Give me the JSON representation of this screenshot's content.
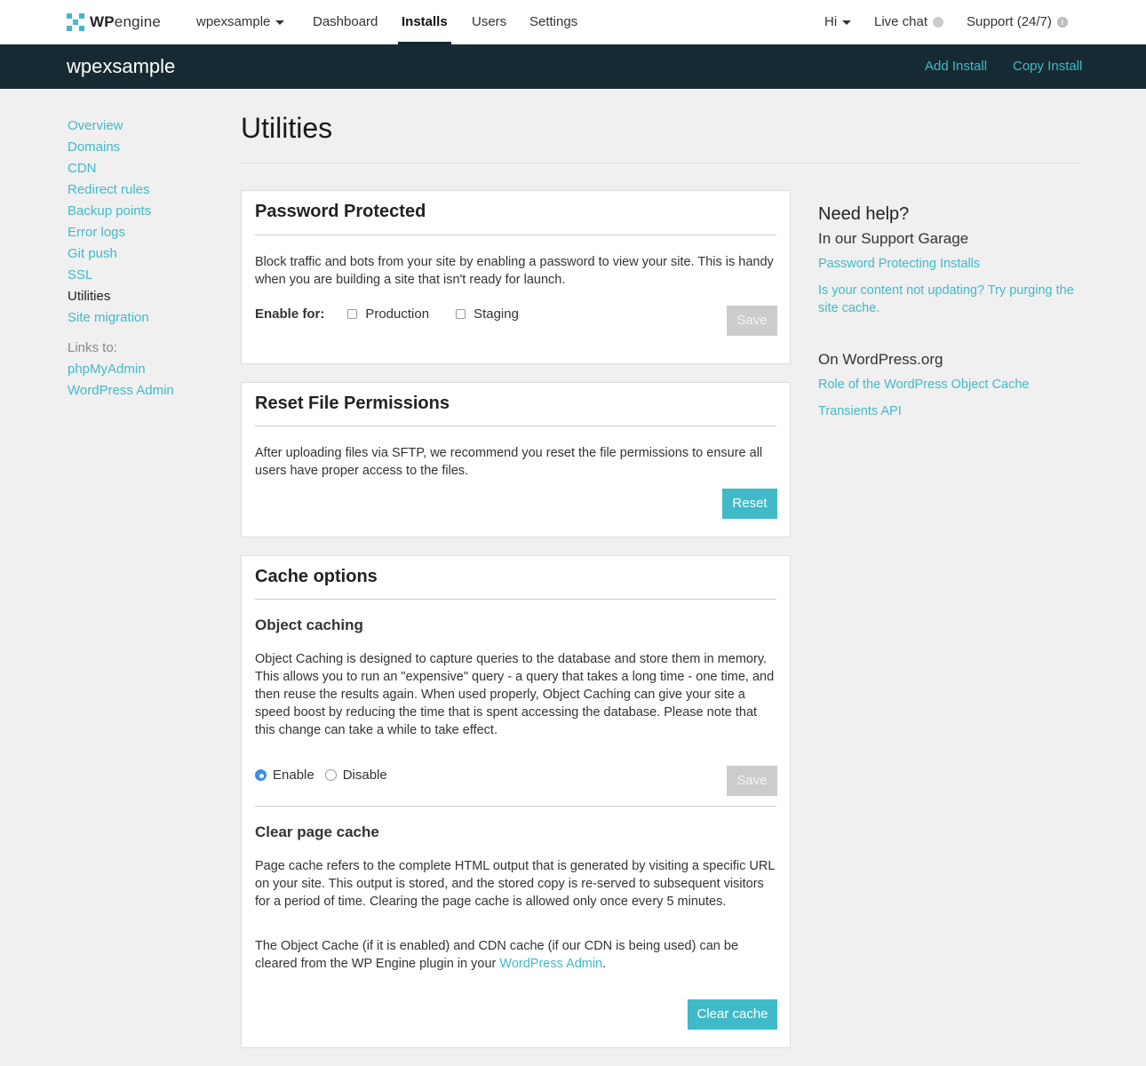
{
  "header": {
    "logo_bold": "WP",
    "logo_light": "engine",
    "site_switcher": "wpexsample",
    "nav": {
      "dashboard": "Dashboard",
      "installs": "Installs",
      "users": "Users",
      "settings": "Settings"
    },
    "greeting": "Hi",
    "live_chat": "Live chat",
    "support": "Support (24/7)"
  },
  "sitebar": {
    "site_name": "wpexsample",
    "add_install": "Add Install",
    "copy_install": "Copy Install"
  },
  "sidebar": {
    "items": [
      "Overview",
      "Domains",
      "CDN",
      "Redirect rules",
      "Backup points",
      "Error logs",
      "Git push",
      "SSL",
      "Utilities",
      "Site migration"
    ],
    "current": "Utilities",
    "links_label": "Links to:",
    "links": [
      "phpMyAdmin",
      "WordPress Admin"
    ]
  },
  "main": {
    "title": "Utilities",
    "password_card": {
      "title": "Password Protected",
      "text": "Block traffic and bots from your site by enabling a password to view your site. This is handy when you are building a site that isn't ready for launch.",
      "enable_label": "Enable for:",
      "production": "Production",
      "staging": "Staging",
      "save": "Save"
    },
    "reset_card": {
      "title": "Reset File Permissions",
      "text": "After uploading files via SFTP, we recommend you reset the file permissions to ensure all users have proper access to the files.",
      "reset": "Reset"
    },
    "cache_card": {
      "title": "Cache options",
      "object_title": "Object caching",
      "object_text": "Object Caching is designed to capture queries to the database and store them in memory. This allows you to run an \"expensive\" query - a query that takes a long time - one time, and then reuse the results again. When used properly, Object Caching can give your site a speed boost by reducing the time that is spent accessing the database. Please note that this change can take a while to take effect.",
      "enable": "Enable",
      "disable": "Disable",
      "selected": "Enable",
      "save": "Save",
      "clear_title": "Clear page cache",
      "clear_text": "Page cache refers to the complete HTML output that is generated by visiting a specific URL on your site. This output is stored, and the stored copy is re-served to subsequent visitors for a period of time. Clearing the page cache is allowed only once every 5 minutes.",
      "note_before": "The Object Cache (if it is enabled) and CDN cache (if our CDN is being used) can be cleared from the WP Engine plugin in your ",
      "note_link": "WordPress Admin",
      "note_after": ".",
      "clear_button": "Clear cache"
    }
  },
  "help": {
    "heading": "Need help?",
    "support_garage": "In our Support Garage",
    "garage_links": [
      "Password Protecting Installs",
      "Is your content not updating? Try purging the site cache."
    ],
    "wordpress_org": "On WordPress.org",
    "org_links": [
      "Role of the WordPress Object Cache",
      "Transients API"
    ]
  },
  "colors": {
    "accent": "#40bac8",
    "dark_bar": "#162a33",
    "radio_selected": "#3b8ee8"
  }
}
